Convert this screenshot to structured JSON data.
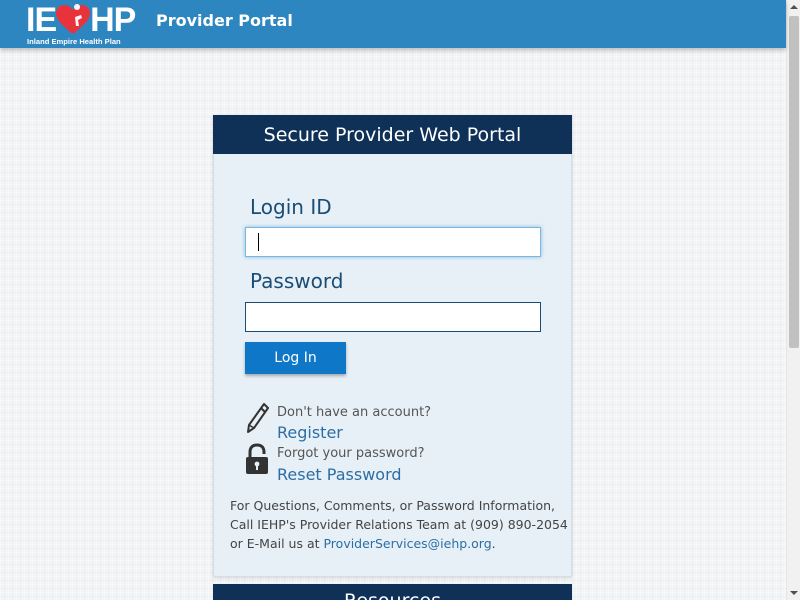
{
  "header": {
    "logo_letters_left": "IE",
    "logo_letters_right": "HP",
    "logo_subtitle": "Inland Empire Health Plan",
    "app_title": "Provider Portal",
    "colors": {
      "bar": "#2e86c1",
      "heart": "#e8333c"
    }
  },
  "login_card": {
    "title": "Secure Provider Web Portal",
    "login_label": "Login ID",
    "login_value": "",
    "password_label": "Password",
    "password_value": "",
    "submit_label": "Log In",
    "register_prompt": "Don't have an account?",
    "register_link": "Register",
    "register_icon": "pencil-icon",
    "forgot_prompt": "Forgot your password?",
    "reset_link": "Reset Password",
    "reset_icon": "unlocked-padlock-icon",
    "info_line1": "For Questions, Comments, or Password Information,",
    "info_line2": "Call IEHP's Provider Relations Team at (909) 890-2054",
    "info_prefix": "or E-Mail us at ",
    "info_email": "ProviderServices@iehp.org",
    "info_suffix": ".",
    "colors": {
      "header": "#0f3057",
      "body": "#e8f0f7",
      "button": "#0f77c8",
      "link": "#2b6ea5"
    }
  },
  "resources_card": {
    "title": "Resources"
  }
}
